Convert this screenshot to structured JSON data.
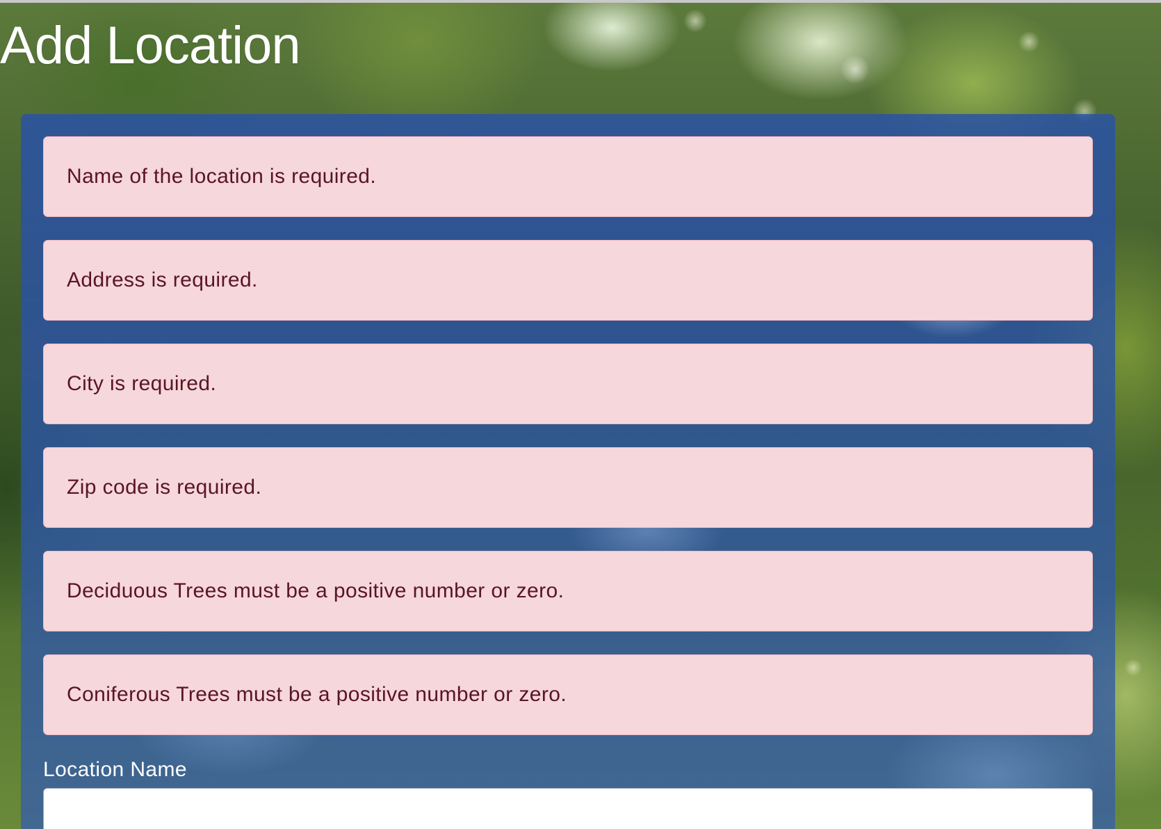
{
  "page": {
    "title": "Add Location"
  },
  "errors": [
    "Name of the location is required.",
    "Address is required.",
    "City is required.",
    "Zip code is required.",
    "Deciduous Trees must be a positive number or zero.",
    "Coniferous Trees must be a positive number or zero."
  ],
  "form": {
    "location_name_label": "Location Name",
    "location_name_value": ""
  },
  "colors": {
    "alert_background": "#f5d7dc",
    "alert_border": "#f0b8c2",
    "alert_text": "#5a1520",
    "panel": "#2d55a8"
  }
}
